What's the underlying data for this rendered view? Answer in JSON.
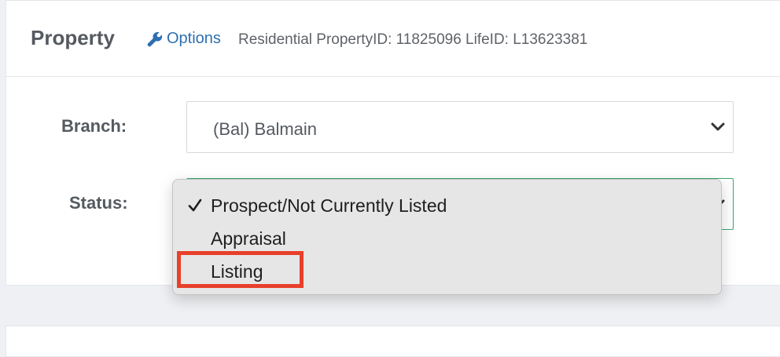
{
  "header": {
    "title": "Property",
    "options_label": "Options",
    "id_text": "Residential PropertyID: 11825096 LifeID: L13623381"
  },
  "form": {
    "branch_label": "Branch:",
    "branch_value": "(Bal) Balmain",
    "status_label": "Status:"
  },
  "status_dropdown": {
    "options": [
      {
        "label": "Prospect/Not Currently Listed",
        "selected": true
      },
      {
        "label": "Appraisal",
        "selected": false
      },
      {
        "label": "Listing",
        "selected": false,
        "highlighted": true
      }
    ]
  },
  "colors": {
    "link": "#2f6fb0",
    "label_text": "#555a60",
    "status_border": "#3aa56b",
    "highlight": "#e8402b",
    "menu_bg": "#e6e6e6"
  },
  "icons": {
    "options": "wrench-icon",
    "select": "chevron-down-icon",
    "selected": "checkmark-icon"
  }
}
